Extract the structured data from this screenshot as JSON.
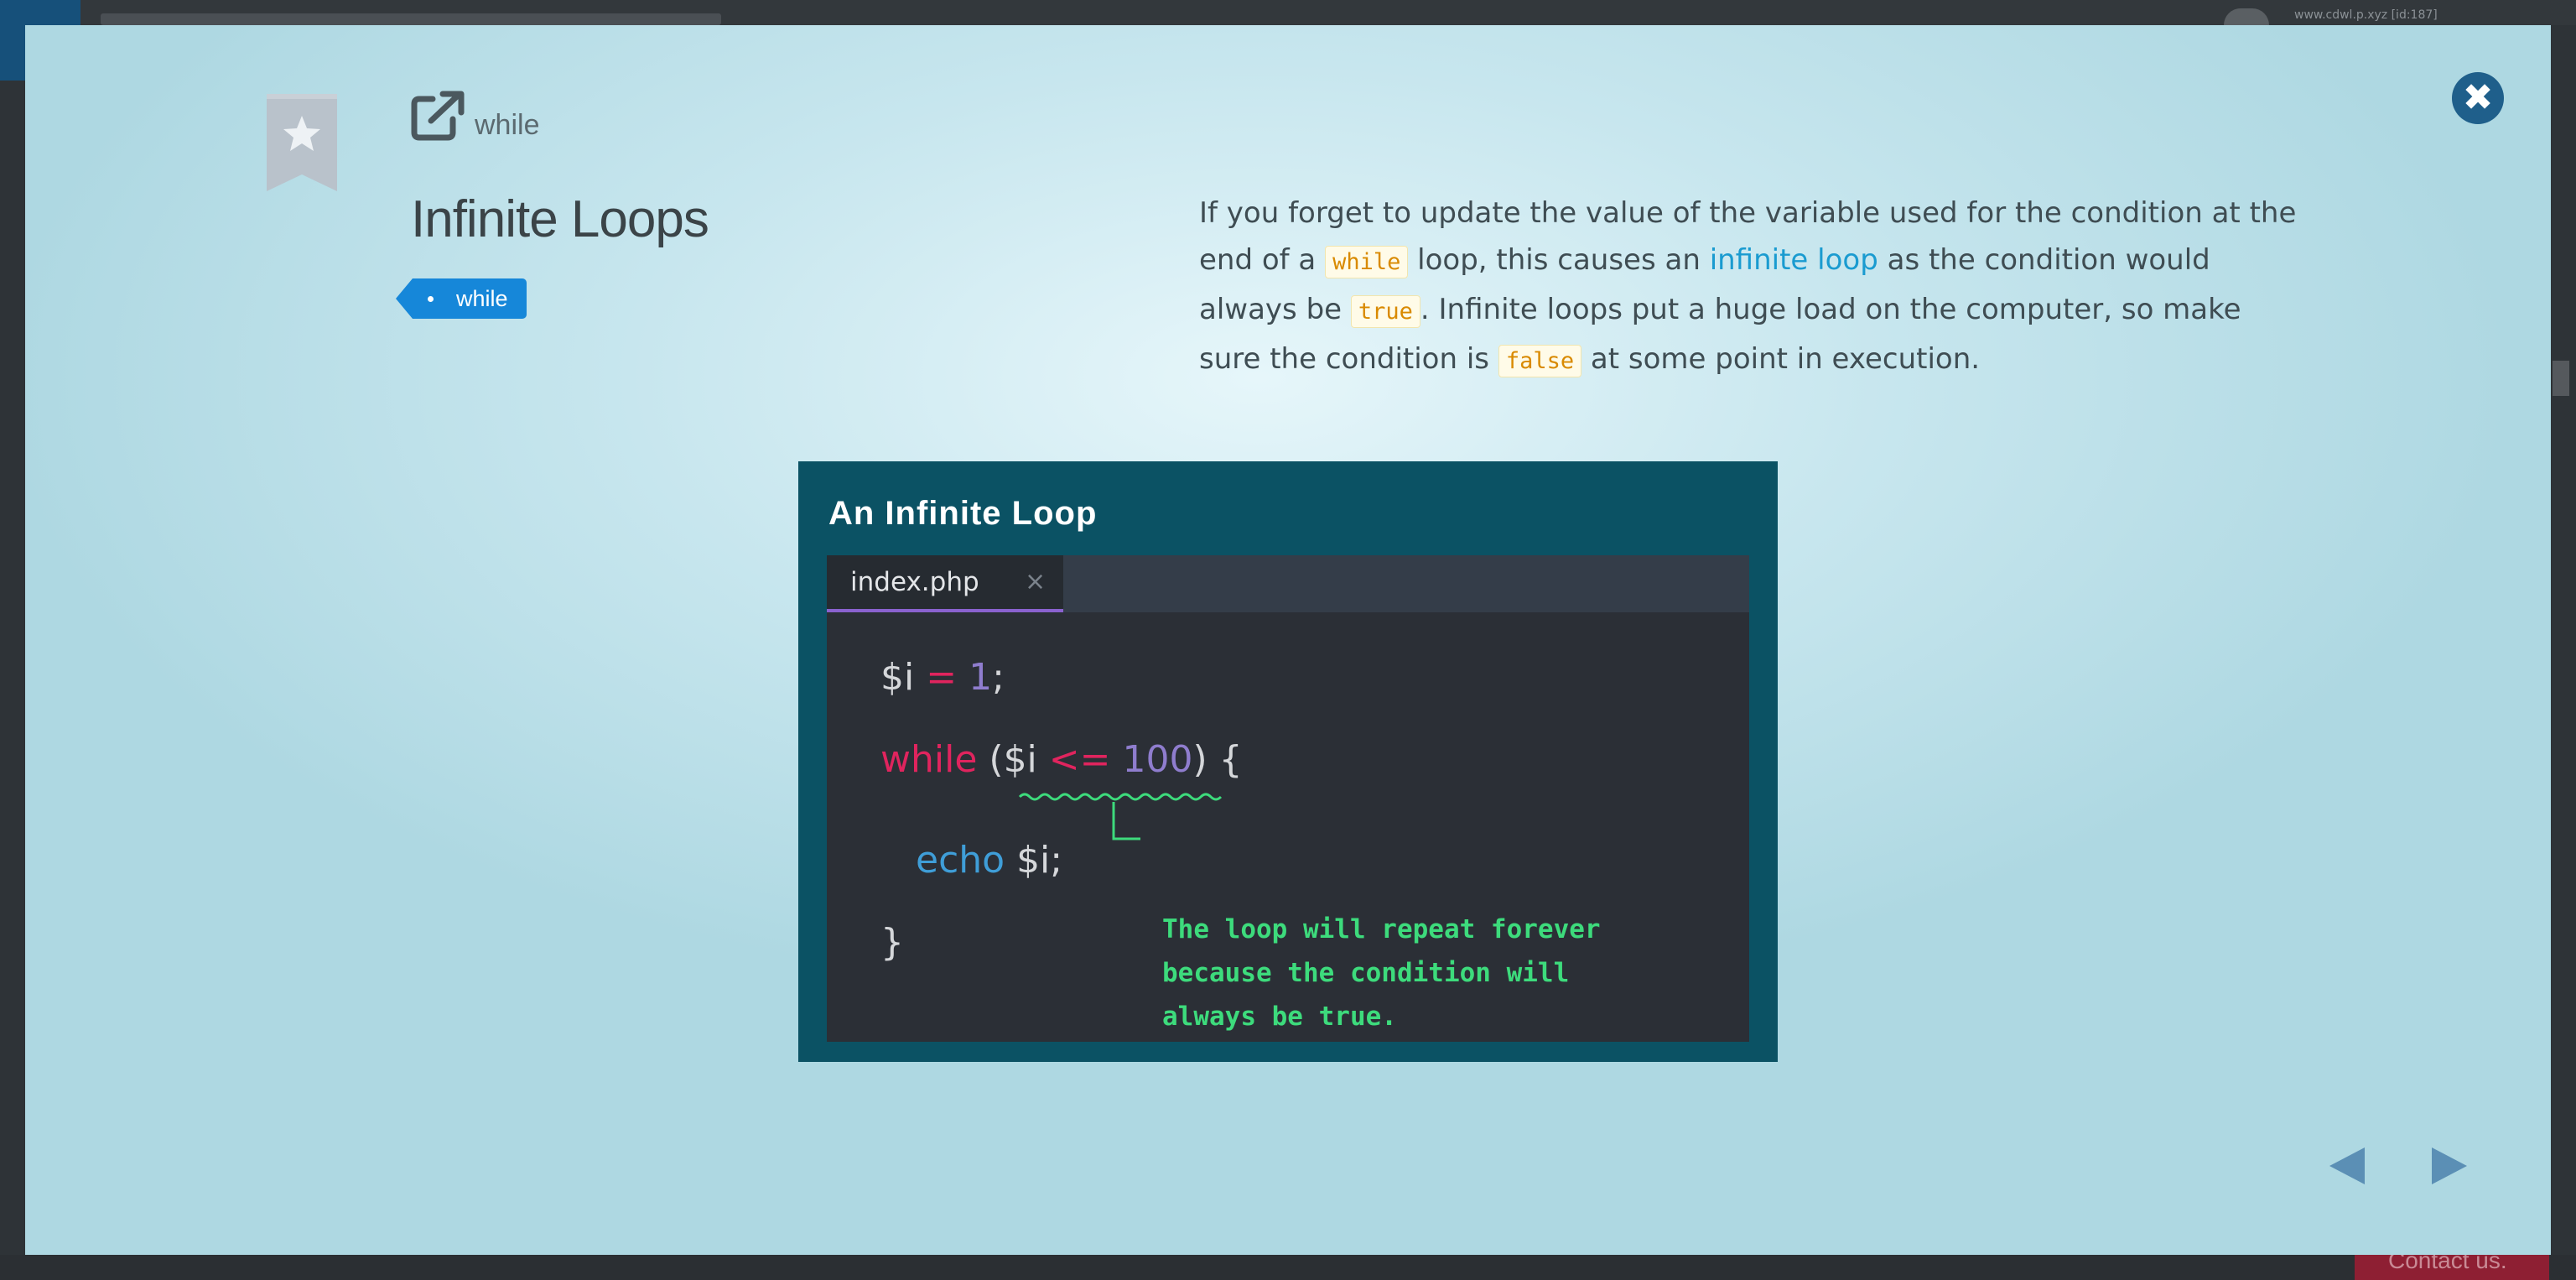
{
  "background": {
    "url_text": "www.cdwl.p.xyz [id:187]",
    "contact_label": "Contact us."
  },
  "modal": {
    "close_icon": "close-icon",
    "bookmark_icon": "star-bookmark-icon",
    "ext_link": {
      "icon": "external-link-icon",
      "label": "while"
    },
    "title": "Infinite Loops",
    "tag": "while",
    "description": {
      "p1": "If you forget to update the value of the variable used for the condition at the end of a ",
      "c1": "while",
      "p2": " loop, this causes an ",
      "link": "infinite loop",
      "p3": " as the condition would always be ",
      "c2": "true",
      "p4": ". Infinite loops put a huge load on the computer, so make sure the condition is ",
      "c3": "false",
      "p5": " at some point in execution."
    },
    "figure": {
      "title": "An Infinite Loop",
      "tab": {
        "filename": "index.php",
        "close": "×"
      },
      "code": {
        "l1_var": "$i",
        "l1_op": " = ",
        "l1_num": "1",
        "l1_end": ";",
        "l2_kw": "while",
        "l2_open": " (",
        "l2_var": "$i ",
        "l2_op": "<=",
        "l2_sp": " ",
        "l2_num": "100",
        "l2_close": ") {",
        "l3_fn": "echo",
        "l3_rest": " $i;",
        "l4": "}"
      },
      "annotation": "The loop will repeat forever because the condition will always be true."
    },
    "nav": {
      "prev_icon": "previous-arrow-icon",
      "next_icon": "next-arrow-icon"
    },
    "colors": {
      "accent": "#1687d9",
      "code_highlight": "#d98a00",
      "annotation": "#3ddb7c"
    }
  }
}
